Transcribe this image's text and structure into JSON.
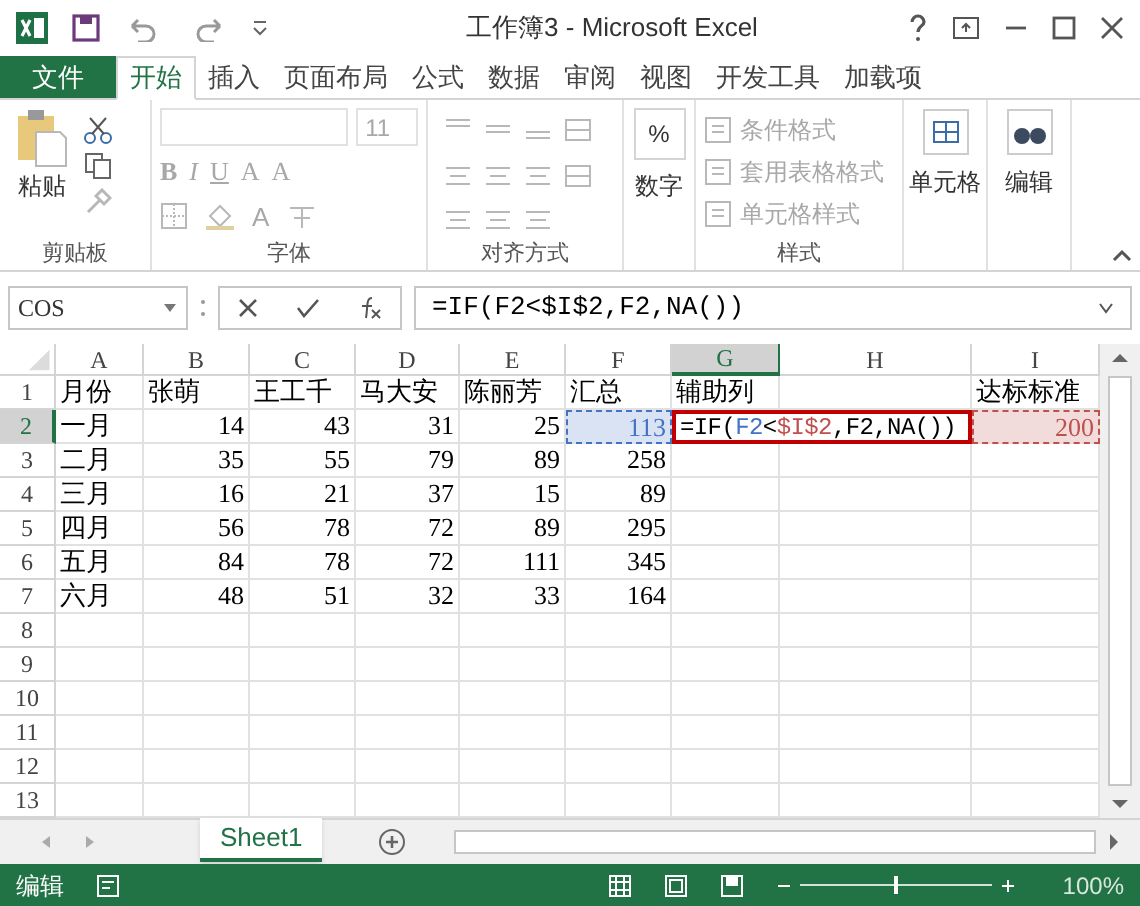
{
  "title_bar": {
    "title": "工作簿3 - Microsoft Excel"
  },
  "tabs": [
    {
      "label": "文件",
      "kind": "file",
      "selected": false
    },
    {
      "label": "开始",
      "kind": "tab",
      "selected": true
    },
    {
      "label": "插入",
      "kind": "tab",
      "selected": false
    },
    {
      "label": "页面布局",
      "kind": "tab",
      "selected": false
    },
    {
      "label": "公式",
      "kind": "tab",
      "selected": false
    },
    {
      "label": "数据",
      "kind": "tab",
      "selected": false
    },
    {
      "label": "审阅",
      "kind": "tab",
      "selected": false
    },
    {
      "label": "视图",
      "kind": "tab",
      "selected": false
    },
    {
      "label": "开发工具",
      "kind": "tab",
      "selected": false
    },
    {
      "label": "加载项",
      "kind": "tab",
      "selected": false
    }
  ],
  "ribbon": {
    "disabled": true,
    "clipboard": {
      "label": "剪贴板",
      "paste": "粘贴"
    },
    "font": {
      "label": "字体",
      "size": "11",
      "buttons": [
        "B",
        "I",
        "U",
        "A",
        "A",
        "A"
      ]
    },
    "alignment": {
      "label": "对齐方式"
    },
    "number": {
      "label": "数字",
      "symbol": "%"
    },
    "styles": {
      "label": "样式",
      "items": [
        "条件格式",
        "套用表格格式",
        "单元格样式"
      ]
    },
    "cells": {
      "label": "单元格"
    },
    "editing": {
      "label": "编辑"
    }
  },
  "formula_bar": {
    "name_box": "COS",
    "formula": "=IF(F2<$I$2,F2,NA())"
  },
  "sheet": {
    "columns": [
      {
        "label": "A",
        "selected": false
      },
      {
        "label": "B",
        "selected": false
      },
      {
        "label": "C",
        "selected": false
      },
      {
        "label": "D",
        "selected": false
      },
      {
        "label": "E",
        "selected": false
      },
      {
        "label": "F",
        "selected": false
      },
      {
        "label": "G",
        "selected": true
      },
      {
        "label": "H",
        "selected": false
      },
      {
        "label": "I",
        "selected": false
      }
    ],
    "rows": [
      {
        "number": "1",
        "selected": false,
        "cells": [
          "月份",
          "张萌",
          "王工千",
          "马大安",
          "陈丽芳",
          "汇总",
          "辅助列",
          null,
          "达标标准"
        ]
      },
      {
        "number": "2",
        "selected": true,
        "cells": [
          "一月",
          "14",
          "43",
          "31",
          "25",
          {
            "text": "113",
            "color": "#4472c4"
          },
          null,
          null,
          {
            "text": "200",
            "color": "#c0504d"
          }
        ]
      },
      {
        "number": "3",
        "selected": false,
        "cells": [
          "二月",
          "35",
          "55",
          "79",
          "89",
          "258",
          null,
          null,
          null
        ]
      },
      {
        "number": "4",
        "selected": false,
        "cells": [
          "三月",
          "16",
          "21",
          "37",
          "15",
          "89",
          null,
          null,
          null
        ]
      },
      {
        "number": "5",
        "selected": false,
        "cells": [
          "四月",
          "56",
          "78",
          "72",
          "89",
          "295",
          null,
          null,
          null
        ]
      },
      {
        "number": "6",
        "selected": false,
        "cells": [
          "五月",
          "84",
          "78",
          "72",
          "111",
          "345",
          null,
          null,
          null
        ]
      },
      {
        "number": "7",
        "selected": false,
        "cells": [
          "六月",
          "48",
          "51",
          "32",
          "33",
          "164",
          null,
          null,
          null
        ]
      },
      {
        "number": "8",
        "selected": false,
        "cells": []
      },
      {
        "number": "9",
        "selected": false,
        "cells": []
      },
      {
        "number": "10",
        "selected": false,
        "cells": []
      },
      {
        "number": "11",
        "selected": false,
        "cells": []
      },
      {
        "number": "12",
        "selected": false,
        "cells": []
      },
      {
        "number": "13",
        "selected": false,
        "cells": []
      }
    ],
    "edit_cell": {
      "segments": [
        {
          "text": "=IF(",
          "color": "#000000"
        },
        {
          "text": "F2",
          "color": "#4472c4"
        },
        {
          "text": "<",
          "color": "#000000"
        },
        {
          "text": "$I$2",
          "color": "#c0504d"
        },
        {
          "text": ",F2,NA())",
          "color": "#000000"
        }
      ]
    }
  },
  "sheet_tabs": [
    {
      "label": "Sheet1",
      "selected": true
    }
  ],
  "status_bar": {
    "mode": "编辑",
    "zoom": "100%",
    "zoom_slider": {
      "level": 0.5
    }
  }
}
